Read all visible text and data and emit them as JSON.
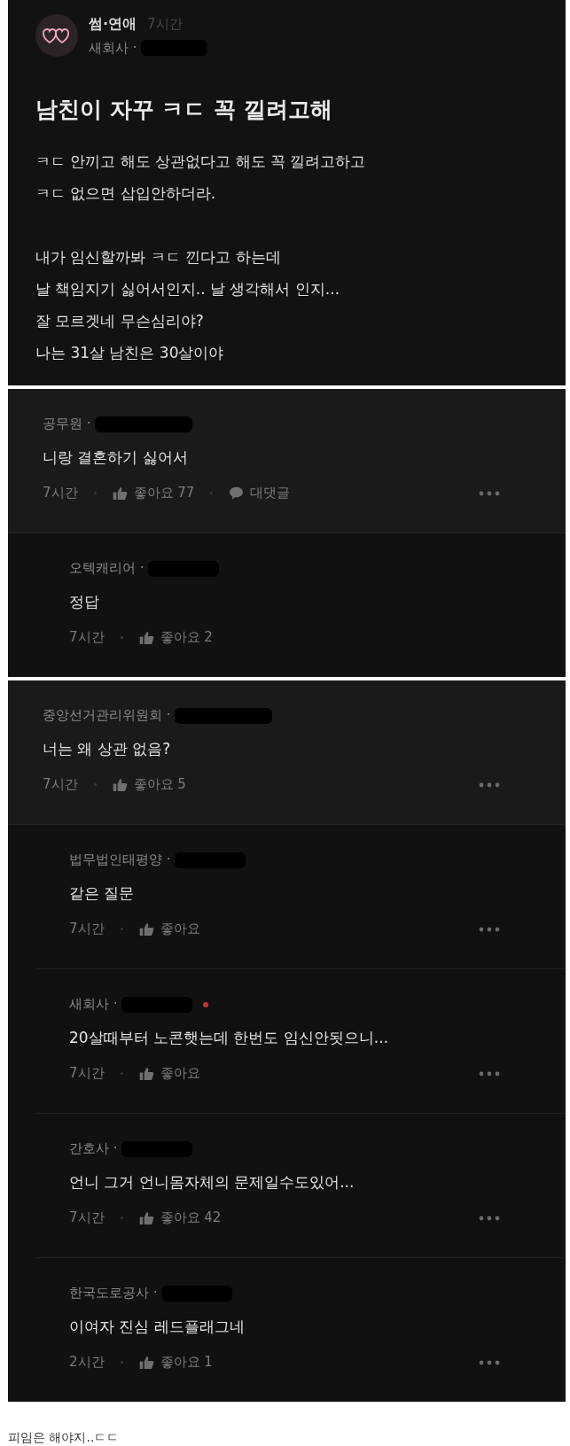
{
  "post": {
    "category": "썸·연애",
    "time": "7시간",
    "company": "새회사 ·",
    "title": "남친이 자꾸 ㅋㄷ 꼭 낄려고해",
    "paragraphs": [
      [
        "ㅋㄷ 안끼고 해도 상관없다고 해도 꼭 낄려고하고",
        "ㅋㄷ 없으면 삽입안하더라."
      ],
      [
        "내가 임신할까봐 ㅋㄷ 낀다고 하는데",
        "날 책임지기 싫어서인지.. 날 생각해서 인지...",
        "잘 모르겟네 무슨심리야?",
        "나는 31살 남친은 30살이야"
      ]
    ]
  },
  "threads": [
    {
      "company": "공무원 ·",
      "text": "니랑 결혼하기 싫어서",
      "time": "7시간",
      "likes": "좋아요 77",
      "reply_label": "대댓글",
      "menu": true,
      "dot": false,
      "replies": [
        {
          "company": "오텍캐리어 ·",
          "text": "정답",
          "time": "7시간",
          "likes": "좋아요 2",
          "menu": false,
          "dot": false
        }
      ]
    },
    {
      "company": "중앙선거관리위원회 ·",
      "text": "너는 왜 상관 없음?",
      "time": "7시간",
      "likes": "좋아요 5",
      "menu": true,
      "dot": false,
      "replies": [
        {
          "company": "법무법인태평양 ·",
          "text": "같은 질문",
          "time": "7시간",
          "likes": "좋아요",
          "menu": true,
          "dot": false
        },
        {
          "company": "새회사 ·",
          "text": "20살때부터 노콘햇는데 한번도 임신안됫으니...",
          "time": "7시간",
          "likes": "좋아요",
          "menu": true,
          "dot": true
        },
        {
          "company": "간호사 ·",
          "text": "언니 그거 언니몸자체의 문제일수도있어...",
          "time": "7시간",
          "likes": "좋아요 42",
          "menu": true,
          "dot": false
        },
        {
          "company": "한국도로공사 ·",
          "text": "이여자 진심 레드플래그네",
          "time": "2시간",
          "likes": "좋아요 1",
          "menu": true,
          "dot": false
        }
      ]
    }
  ],
  "caption": "피임은 해야지..ㄷㄷ"
}
